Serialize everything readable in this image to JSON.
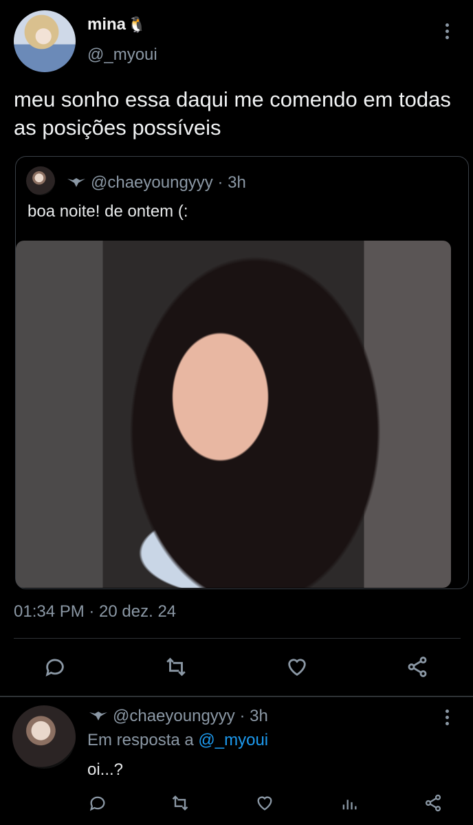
{
  "tweet": {
    "author_name": "mina",
    "name_emoji": "🐧",
    "author_handle": "@_myoui",
    "text": "meu sonho essa daqui me comendo em todas as posições possíveis",
    "timestamp": "01:34 PM · 20 dez. 24",
    "more_icon": "more-vertical-icon"
  },
  "quoted_tweet": {
    "handle_time": "@chaeyoungyyy · 3h",
    "text": "boa noite! de ontem (:",
    "media": "photo"
  },
  "actions": {
    "icons": [
      "reply-icon",
      "retweet-icon",
      "like-icon",
      "share-icon"
    ]
  },
  "reply": {
    "handle_time": "@chaeyoungyyy · 3h",
    "replying_prefix": "Em resposta a",
    "replying_mention": "@_myoui",
    "text": "oi...?",
    "icons": [
      "reply-icon",
      "retweet-icon",
      "like-icon",
      "analytics-icon",
      "share-icon"
    ]
  },
  "colors": {
    "background": "#000000",
    "secondary_text": "#8b98a5",
    "link": "#1d9bf0",
    "divider": "#2f3336"
  }
}
